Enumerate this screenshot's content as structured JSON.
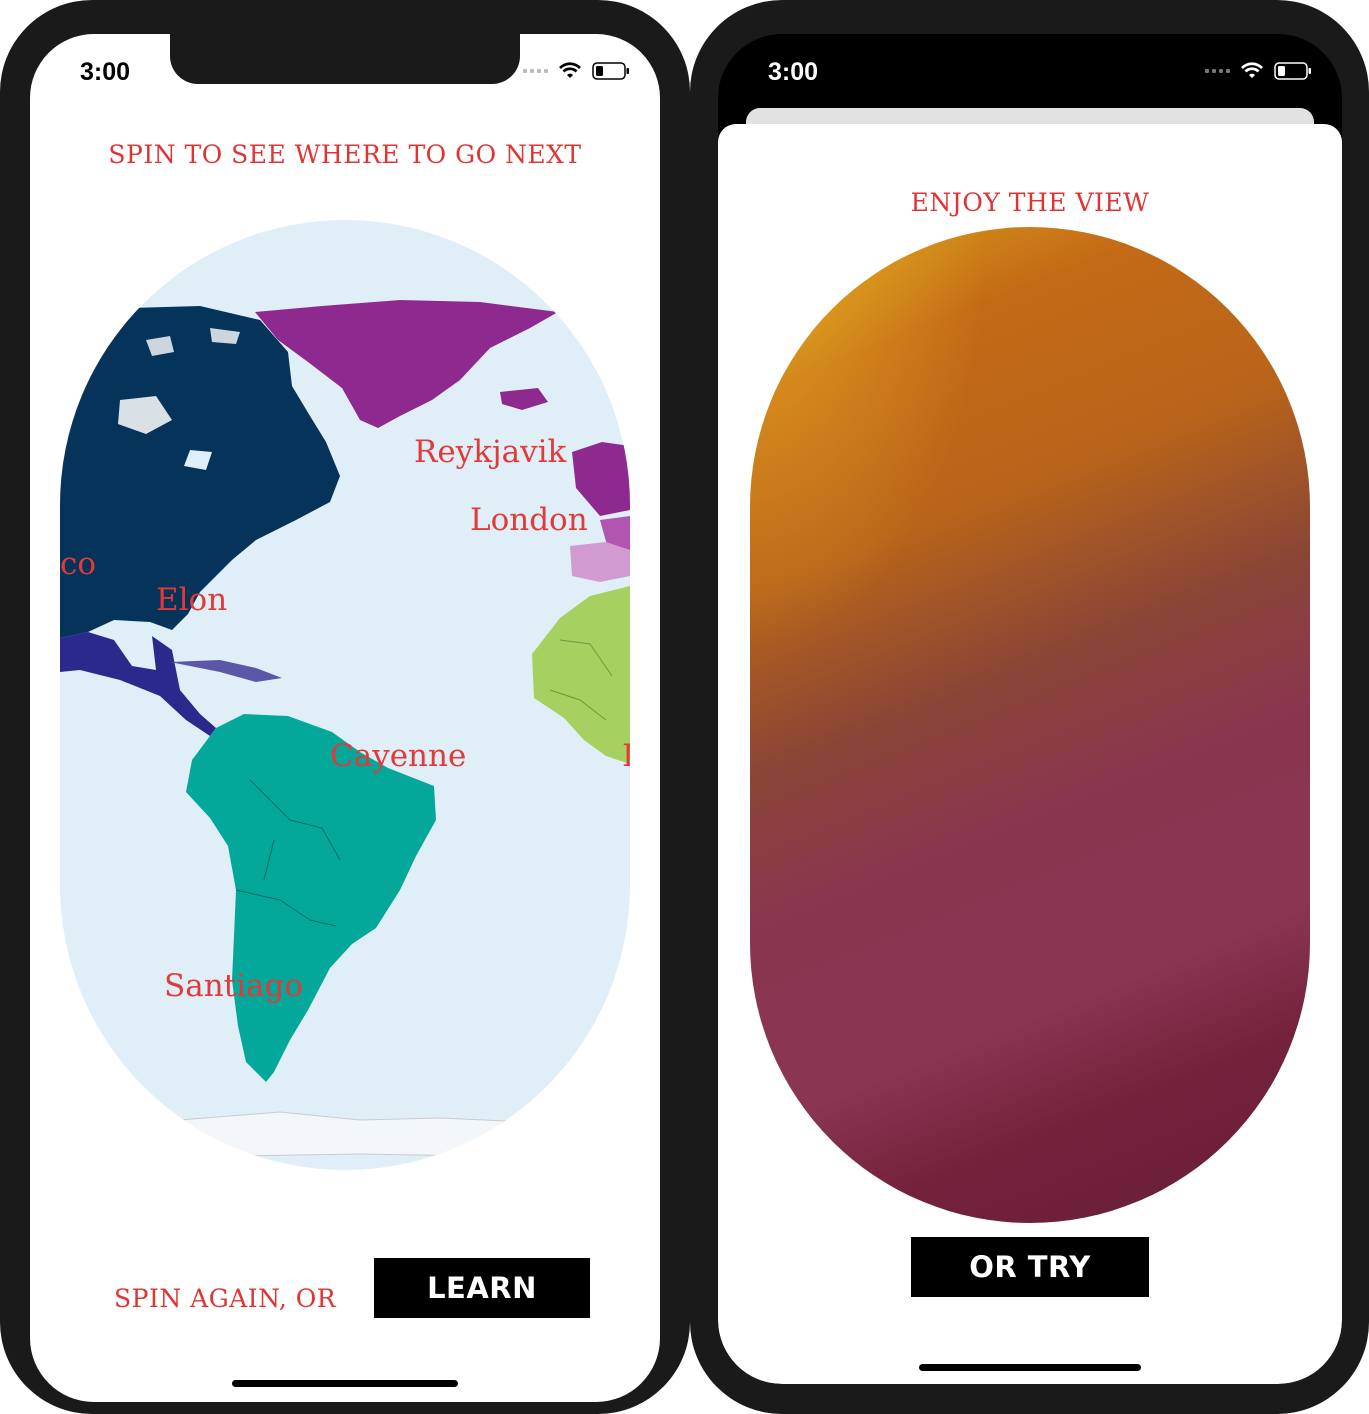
{
  "left_screen": {
    "status": {
      "time": "3:00"
    },
    "title": "SPIN TO SEE WHERE TO GO NEXT",
    "map": {
      "cities": [
        "Reykjavik",
        "London",
        "co",
        "Elon",
        "Cayenne",
        "Santiago",
        "I"
      ]
    },
    "footer": {
      "spin_again": "SPIN AGAIN, OR",
      "learn_more": "LEARN MORE"
    }
  },
  "right_screen": {
    "status": {
      "time": "3:00"
    },
    "title": "ENJOY THE VIEW",
    "view": {
      "gradient_colors": [
        "#d9a21b",
        "#c46a16",
        "#8a3550",
        "#6b1f39",
        "#4a2733"
      ]
    },
    "try_again": "OR TRY AGAIN"
  },
  "colors": {
    "accent_red": "#e03434",
    "ocean": "#e0eff7",
    "north_america": "#06335a",
    "central_america": "#2b2a8c",
    "greenland": "#8e2a8f",
    "south_america": "#04a89a",
    "africa": "#a6d160"
  }
}
